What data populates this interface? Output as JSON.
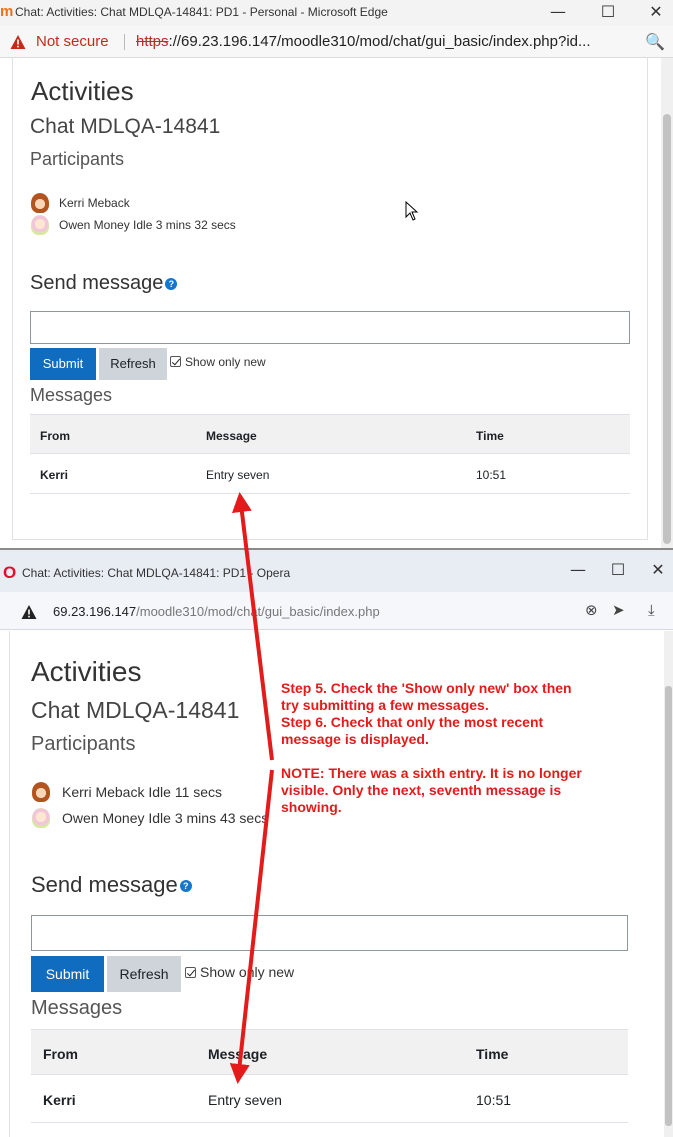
{
  "edge": {
    "window_title": "Chat: Activities: Chat MDLQA-14841: PD1 - Personal - Microsoft Edge",
    "app_icon": "m",
    "controls": {
      "minimize": "—",
      "maximize": "☐",
      "close": "✕"
    },
    "not_secure": "Not secure",
    "url_scheme": "https",
    "url_rest": "://69.23.196.147/moodle310/mod/chat/gui_basic/index.php?id...",
    "search_icon": "🔍",
    "page": {
      "heading": "Activities",
      "chat_title": "Chat MDLQA-14841",
      "participants_heading": "Participants",
      "participants": [
        {
          "name": "Kerri Meback"
        },
        {
          "name": "Owen Money Idle 3 mins 32 secs"
        }
      ],
      "send_heading": "Send message",
      "help": "?",
      "submit": "Submit",
      "refresh": "Refresh",
      "show_only_new": "Show only new",
      "messages_heading": "Messages",
      "table": {
        "headers": [
          "From",
          "Message",
          "Time"
        ],
        "rows": [
          {
            "from": "Kerri",
            "message": "Entry seven",
            "time": "10:51"
          }
        ]
      }
    }
  },
  "opera": {
    "window_title": "Chat: Activities: Chat MDLQA-14841: PD1 - Opera",
    "logo": "O",
    "controls": {
      "minimize": "—",
      "maximize": "☐",
      "close": "✕"
    },
    "url_host": "69.23.196.147",
    "url_path": "/moodle310/mod/chat/gui_basic/index.php",
    "icons": {
      "clear": "⊗",
      "send": "➤",
      "download": "⤓"
    },
    "page": {
      "heading": "Activities",
      "chat_title": "Chat MDLQA-14841",
      "participants_heading": "Participants",
      "participants": [
        {
          "name": "Kerri Meback Idle 11 secs"
        },
        {
          "name": "Owen Money Idle 3 mins 43 secs"
        }
      ],
      "send_heading": "Send message",
      "help": "?",
      "submit": "Submit",
      "refresh": "Refresh",
      "show_only_new": "Show only new",
      "messages_heading": "Messages",
      "table": {
        "headers": [
          "From",
          "Message",
          "Time"
        ],
        "rows": [
          {
            "from": "Kerri",
            "message": "Entry seven",
            "time": "10:51"
          }
        ]
      }
    }
  },
  "annotation": {
    "lines": [
      "Step 5. Check the 'Show only new' box then",
      "try submitting a few messages.",
      "Step 6. Check that only the most recent",
      "message is displayed.",
      "",
      "NOTE:  There was a sixth entry. It is no longer",
      "visible. Only the next, seventh message is",
      "showing."
    ],
    "color": "#e31b1b"
  }
}
